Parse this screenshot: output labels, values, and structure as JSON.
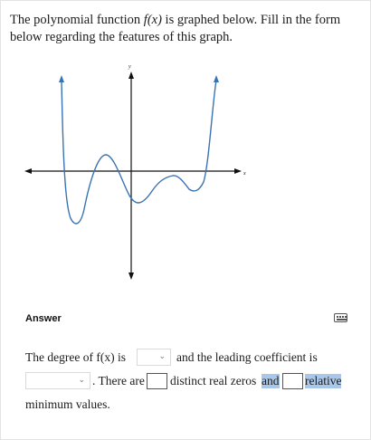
{
  "question": {
    "text_before": "The polynomial function ",
    "function_name": "f(x)",
    "text_after": " is graphed below. Fill in the form below regarding the features of this graph."
  },
  "graph": {
    "x_axis_label": "x",
    "y_axis_label": "y",
    "curve_color": "#3a73b3",
    "axis_color": "#111111"
  },
  "answer": {
    "label": "Answer",
    "keyboard_icon": "keyboard-icon",
    "sentence_1": "The degree of f(x) is",
    "degree_value": "",
    "sentence_2": "and the leading coefficient is",
    "leading_coefficient_value": "",
    "sentence_3": ". There are",
    "distinct_zeros_value": "",
    "sentence_4": "distinct real zeros",
    "sentence_5": "and",
    "relative_min_value": "",
    "sentence_6": "relative",
    "sentence_7": "minimum values.",
    "chevron_icon": "chevron-down-icon"
  }
}
